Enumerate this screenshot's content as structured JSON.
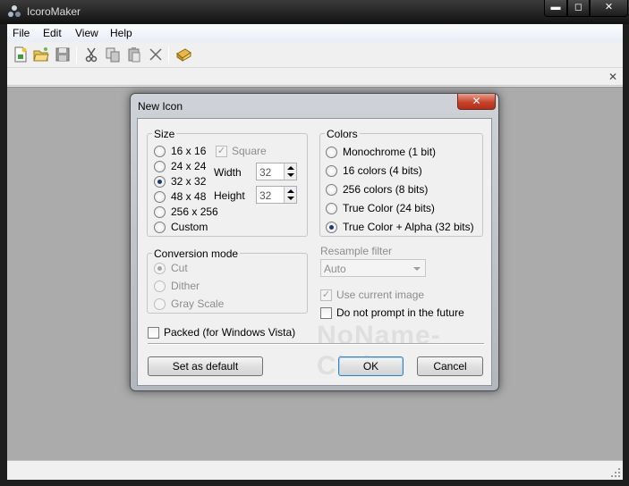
{
  "window": {
    "title": "IcoroMaker",
    "controls": {
      "minimize": "▬",
      "maximize": "◻",
      "close": "✕"
    }
  },
  "menu": [
    "File",
    "Edit",
    "View",
    "Help"
  ],
  "toolbar": [
    "new-icon",
    "open-icon",
    "save-icon",
    "cut-icon",
    "copy-icon",
    "paste-icon",
    "delete-icon",
    "extract-icon"
  ],
  "doc_close": "✕",
  "dialog": {
    "title": "New Icon",
    "close": "✕",
    "size": {
      "label": "Size",
      "options": [
        "16 x 16",
        "24 x 24",
        "32 x 32",
        "48 x 48",
        "256 x 256",
        "Custom"
      ],
      "selected": "32 x 32",
      "square_label": "Square",
      "width_label": "Width",
      "width_value": "32",
      "height_label": "Height",
      "height_value": "32"
    },
    "colors": {
      "label": "Colors",
      "options": [
        "Monochrome (1 bit)",
        "16 colors (4 bits)",
        "256 colors (8 bits)",
        "True Color (24 bits)",
        "True Color + Alpha (32 bits)"
      ],
      "selected": "True Color + Alpha (32 bits)"
    },
    "conversion": {
      "label": "Conversion mode",
      "options": [
        "Cut",
        "Dither",
        "Gray Scale"
      ],
      "selected": "Cut"
    },
    "resample": {
      "label": "Resample filter",
      "value": "Auto"
    },
    "use_current_image": "Use current image",
    "do_not_prompt": "Do not prompt in the future",
    "packed": "Packed (for Windows Vista)",
    "buttons": {
      "set_default": "Set as default",
      "ok": "OK",
      "cancel": "Cancel"
    },
    "watermark": "NoName-Club"
  }
}
